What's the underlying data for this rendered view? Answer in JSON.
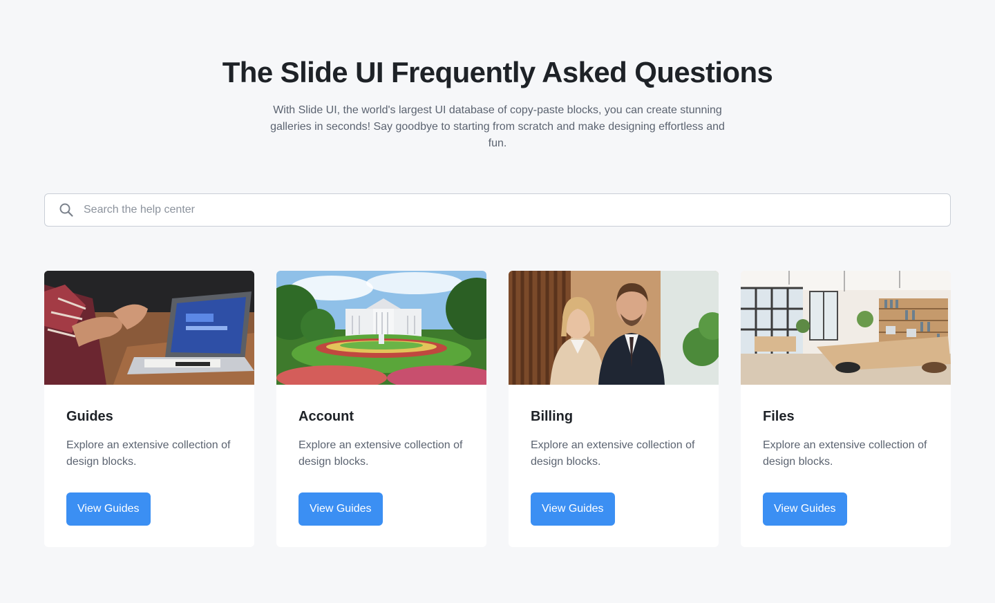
{
  "header": {
    "title": "The Slide UI Frequently Asked Questions",
    "subtitle": "With Slide UI, the world's largest UI database of copy-paste blocks, you can create stunning galleries in seconds! Say goodbye to starting from scratch and make designing effortless and fun."
  },
  "search": {
    "placeholder": "Search the help center",
    "value": "",
    "icon": "search-icon"
  },
  "colors": {
    "page_background": "#f6f7f9",
    "accent": "#3b8ff3",
    "card_background": "#ffffff"
  },
  "cards": [
    {
      "title": "Guides",
      "description": "Explore an extensive collection of design blocks.",
      "button_label": "View Guides",
      "image": "team-laptop-photo"
    },
    {
      "title": "Account",
      "description": "Explore an extensive collection of design blocks.",
      "button_label": "View Guides",
      "image": "white-house-garden-photo"
    },
    {
      "title": "Billing",
      "description": "Explore an extensive collection of design blocks.",
      "button_label": "View Guides",
      "image": "business-couple-photo"
    },
    {
      "title": "Files",
      "description": "Explore an extensive collection of design blocks.",
      "button_label": "View Guides",
      "image": "office-interior-photo"
    }
  ]
}
